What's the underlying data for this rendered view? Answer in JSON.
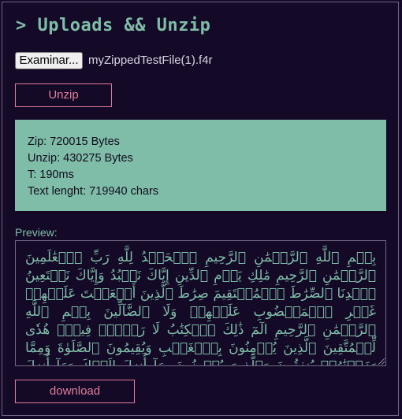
{
  "app": {
    "title": "> Uploads && Unzip"
  },
  "file_input": {
    "button_label": "Examinar...",
    "file_name": "myZippedTestFile(1).f4r"
  },
  "unzip_button": {
    "label": "Unzip"
  },
  "stats": {
    "zip": "Zip: 720015 Bytes",
    "unzip": "Unzip: 430275 Bytes",
    "time": "T: 190ms",
    "text_length": "Text lenght: 719940 chars"
  },
  "preview": {
    "label": "Preview:",
    "text": "بِسۡمِ ٱللَّهِ ٱلرَّحۡمَٰنِ ٱلرَّحِيمِ ٱلۡحَمۡدُ لِلَّهِ رَبِّ ٱلۡعَٰلَمِينَ ٱلرَّحۡمَٰنِ ٱلرَّحِيمِ مَٰلِكِ يَوۡمِ ٱلدِّينِ إِيَّاكَ نَعۡبُدُ وَإِيَّاكَ نَسۡتَعِينُ ٱهۡدِنَا ٱلصِّرَٰطَ ٱلۡمُسۡتَقِيمَ صِرَٰطَ ٱلَّذِينَ أَنۡعَمۡتَ عَلَيۡهِمۡ غَيۡرِ ٱلۡمَغۡضُوبِ عَلَيۡهِمۡ وَلَا ٱلضَّآلِّينَ بِسۡمِ ٱللَّهِ ٱلرَّحۡمَٰنِ ٱلرَّحِيمِ الٓمٓ ذَٰلِكَ ٱلۡكِتَٰبُ لَا رَيۡبَۛ فِيهِۛ هُدٗى لِّلۡمُتَّقِينَ ٱلَّذِينَ يُؤۡمِنُونَ بِٱلۡغَيۡبِ وَيُقِيمُونَ ٱلصَّلَوٰةَ وَمِمَّا رَزَقۡنَٰهُمۡ يُنفِقُونَ وَٱلَّذِينَ يُؤۡمِنُونَ بِمَآ أُنزِلَ إِلَيۡكَ وَمَآ أُنزِلَ مِن قَبۡلِكَ وَبِٱلۡأٓخِرَةِ هُمۡ يُوقِنُونَ أُوْلَٰٓئِكَ عَلَىٰ هُدٗى مِّن رَّبِّهِمۡۖ وَأُوْلَٰٓئِكَ هُمُ ٱلۡمُفۡلِحُونَ إِنَّ ٱلَّذِينَ كَفَرُواْ سَوَآءٌ عَلَيۡهِمۡ"
  },
  "download_button": {
    "label": "download"
  },
  "colors": {
    "background": "#140a27",
    "accent_teal": "#7fbda8",
    "accent_pink": "#e07d9c",
    "border": "#6f6a82"
  }
}
